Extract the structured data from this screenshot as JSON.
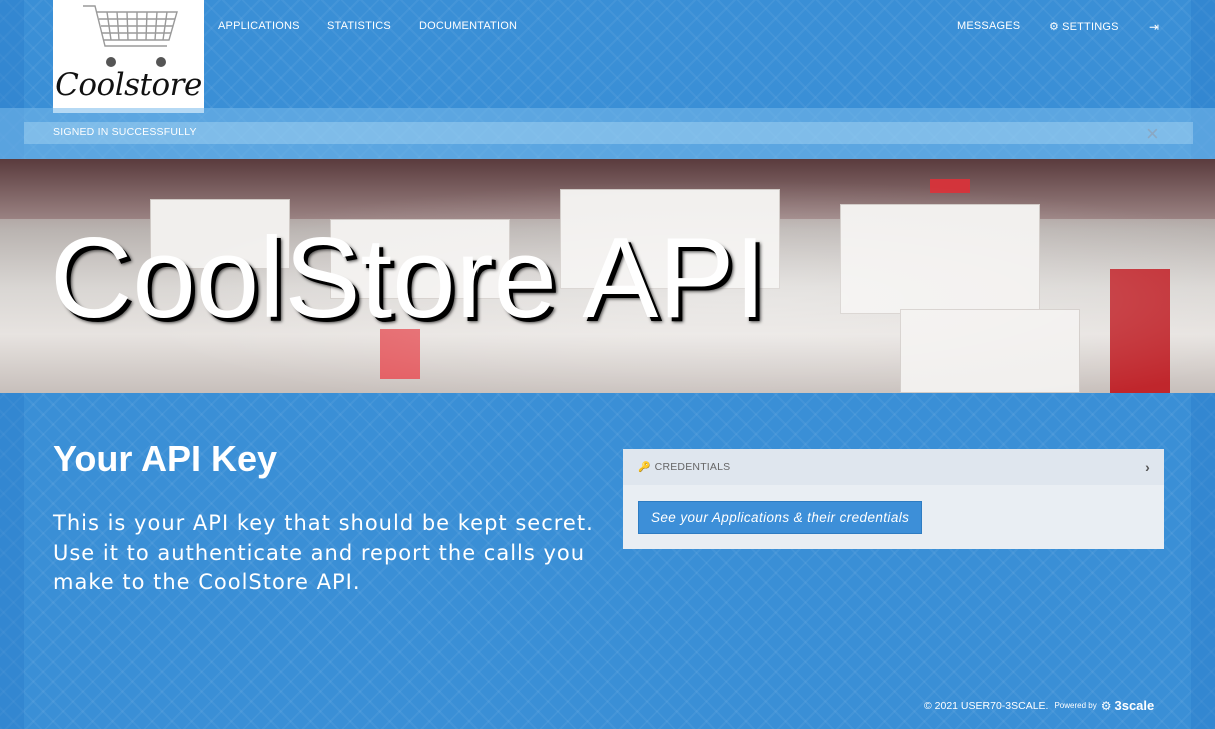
{
  "brand": {
    "logo_text": "Coolstore"
  },
  "nav": {
    "applications": "APPLICATIONS",
    "statistics": "STATISTICS",
    "documentation": "DOCUMENTATION",
    "messages": "MESSAGES",
    "settings": "SETTINGS"
  },
  "alert": {
    "text": "SIGNED IN SUCCESSFULLY",
    "close": "×"
  },
  "hero": {
    "title": "CoolStore API"
  },
  "main": {
    "title": "Your API Key",
    "description": "This is your API key that should be kept secret. Use it to authenticate and report the calls you make to the CoolStore API."
  },
  "panel": {
    "header": "CREDENTIALS",
    "button": "See your Applications & their credentials"
  },
  "footer": {
    "copyright": "© 2021 USER70-3SCALE.",
    "powered_by": "Powered by",
    "powered_brand": "3scale"
  },
  "colors": {
    "accent": "#3a8fd6",
    "panel_bg": "#e9eef3"
  }
}
